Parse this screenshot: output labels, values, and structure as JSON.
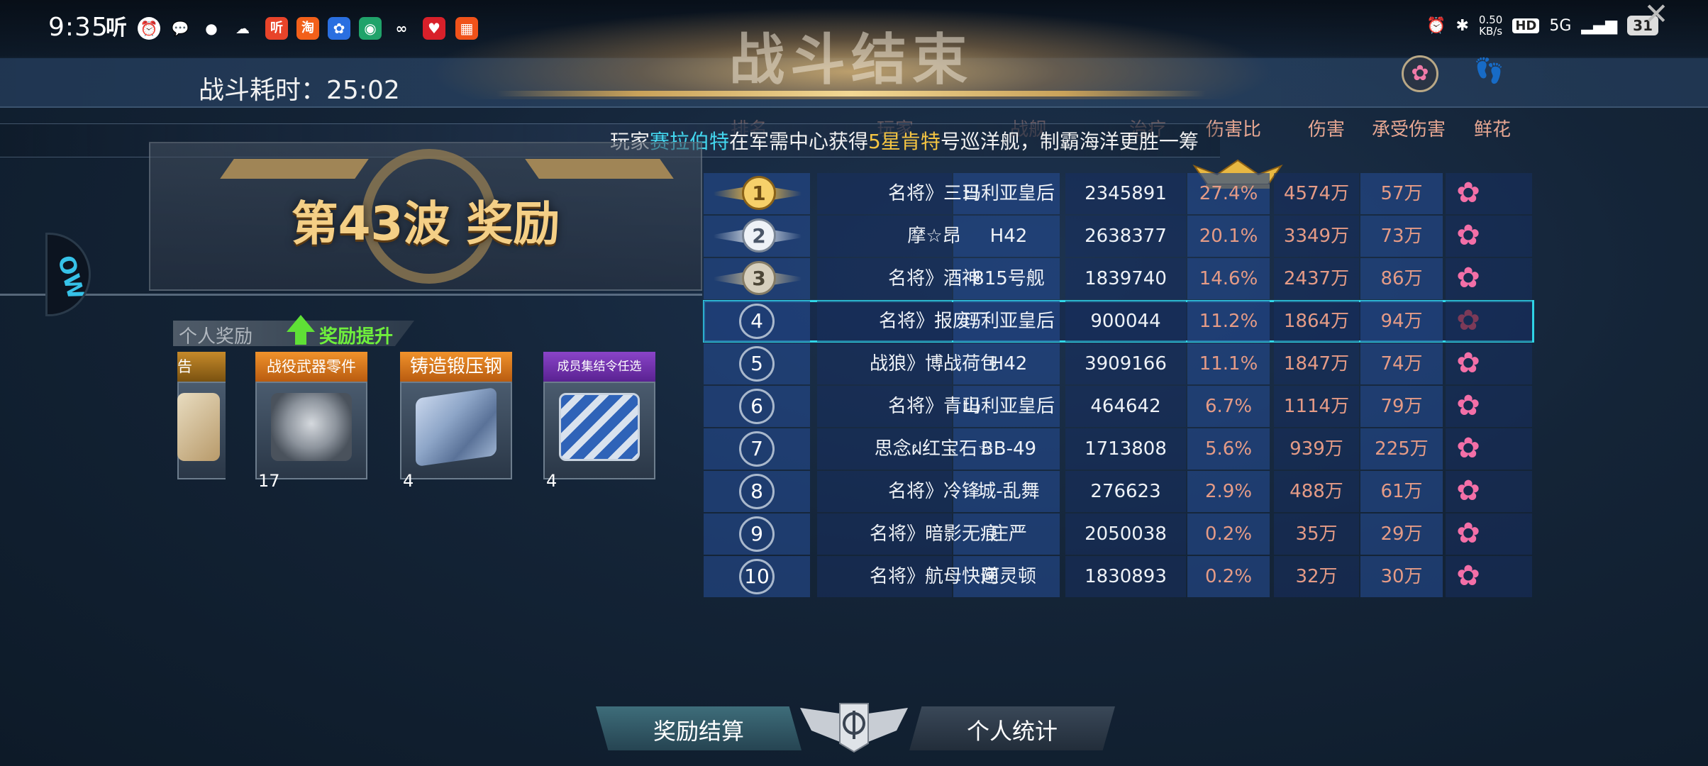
{
  "status_bar": {
    "time": "9:35",
    "app_icons": [
      "听",
      "alarm-icon",
      "wechat-icon",
      "chat-icon",
      "cloud-icon",
      "听",
      "淘",
      "app-icon",
      "app-icon",
      "app-icon",
      "app-icon",
      "app-icon"
    ],
    "net_speed": "0.50",
    "net_speed_unit": "KB/s",
    "hd": "HD",
    "signal": "5G",
    "battery": "31"
  },
  "header": {
    "title": "战斗结束",
    "battle_time": "战斗耗时：25:02"
  },
  "ticker": {
    "prefix": "玩家",
    "player": "赛拉伯特",
    "middle": "在军需中心获得",
    "ship": "5星肯特",
    "suffix": "号巡洋舰，制霸海洋更胜一筹"
  },
  "wave": {
    "title": "第43波 奖励",
    "personal_tab": "个人奖励",
    "boost": "奖励提升"
  },
  "rewards": [
    {
      "name": "告",
      "count": "",
      "color": "#c68a2a"
    },
    {
      "name": "战役武器零件",
      "count": "17",
      "color": "#f0922b"
    },
    {
      "name": "铸造锻压钢",
      "count": "4",
      "color": "#f0922b"
    },
    {
      "name": "成员集结令任选",
      "count": "4",
      "color": "#8a44c8"
    }
  ],
  "table": {
    "headers": [
      "排名",
      "玩家",
      "战舰",
      "治疗",
      "伤害比",
      "伤害",
      "承受伤害",
      "鲜花"
    ],
    "rows": [
      {
        "rank": "1",
        "player": "名将》三日",
        "ship": "玛利亚皇后",
        "heal": "2345891",
        "ratio": "27.4%",
        "damage": "4574万",
        "taken": "57万"
      },
      {
        "rank": "2",
        "player": "摩☆昂",
        "ship": "H42",
        "heal": "2638377",
        "ratio": "20.1%",
        "damage": "3349万",
        "taken": "73万"
      },
      {
        "rank": "3",
        "player": "名将》酒神",
        "ship": "815号舰",
        "heal": "1839740",
        "ratio": "14.6%",
        "damage": "2437万",
        "taken": "86万"
      },
      {
        "rank": "4",
        "player": "名将》报废厂",
        "ship": "玛利亚皇后",
        "heal": "900044",
        "ratio": "11.2%",
        "damage": "1864万",
        "taken": "94万"
      },
      {
        "rank": "5",
        "player": "战狼》博战荷包",
        "ship": "H42",
        "heal": "3909166",
        "ratio": "11.1%",
        "damage": "1847万",
        "taken": "74万"
      },
      {
        "rank": "6",
        "player": "名将》青山",
        "ship": "玛利亚皇后",
        "heal": "464642",
        "ratio": "6.7%",
        "damage": "1114万",
        "taken": "79万"
      },
      {
        "rank": "7",
        "player": "思念ฝ红宝石☆",
        "ship": "BB-49",
        "heal": "1713808",
        "ratio": "5.6%",
        "damage": "939万",
        "taken": "225万"
      },
      {
        "rank": "8",
        "player": "名将》冷锋",
        "ship": "城-乱舞",
        "heal": "276623",
        "ratio": "2.9%",
        "damage": "488万",
        "taken": "61万"
      },
      {
        "rank": "9",
        "player": "名将》暗影无痕",
        "ship": "庄严",
        "heal": "2050038",
        "ratio": "0.2%",
        "damage": "35万",
        "taken": "29万"
      },
      {
        "rank": "10",
        "player": "名将》航母快递",
        "ship": "阿灵顿",
        "heal": "1830893",
        "ratio": "0.2%",
        "damage": "32万",
        "taken": "30万"
      }
    ]
  },
  "bottom_nav": {
    "reward_settlement": "奖励结算",
    "personal_stats": "个人统计"
  },
  "colors": {
    "accent_cyan": "#2fd4e6",
    "gold": "#f4cf86",
    "rose": "#f36fa7",
    "boost_green": "#6ff03c"
  }
}
